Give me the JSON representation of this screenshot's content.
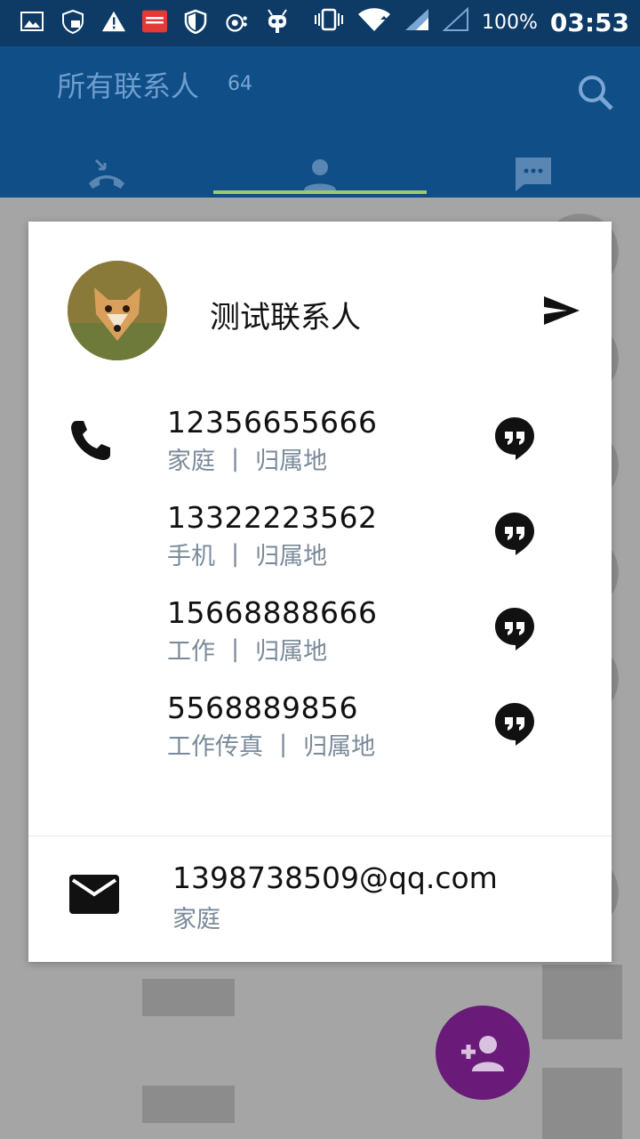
{
  "status_bar": {
    "battery_percent": "100%",
    "time": "03:53",
    "icons": [
      "image-icon",
      "shield-lock-icon",
      "warning-icon",
      "money-locker-icon",
      "shield-icon",
      "camera-icon",
      "robot-icon",
      "vibrate-icon",
      "wifi-icon",
      "signal-icon",
      "signal-empty-icon"
    ]
  },
  "header": {
    "title": "所有联系人",
    "count": "64"
  },
  "tabs": [
    {
      "name": "calls",
      "icon": "call-history-icon"
    },
    {
      "name": "contacts",
      "icon": "person-icon"
    },
    {
      "name": "messages",
      "icon": "chat-icon"
    }
  ],
  "dialog": {
    "contact_name": "测试联系人",
    "phones": [
      {
        "number": "12356655666",
        "type": "家庭",
        "separator": "|",
        "location": "归属地"
      },
      {
        "number": "13322223562",
        "type": "手机",
        "separator": "|",
        "location": "归属地"
      },
      {
        "number": "15668888666",
        "type": "工作",
        "separator": "|",
        "location": "归属地"
      },
      {
        "number": "5568889856",
        "type": "工作传真",
        "separator": "|",
        "location": "归属地"
      }
    ],
    "email": {
      "address": "1398738509@qq.com",
      "type": "家庭"
    }
  },
  "colors": {
    "status_bar": "#0d3b66",
    "app_bar": "#0f4e86",
    "tab_indicator": "#9ccc65",
    "fab": "#6a1b7a"
  }
}
